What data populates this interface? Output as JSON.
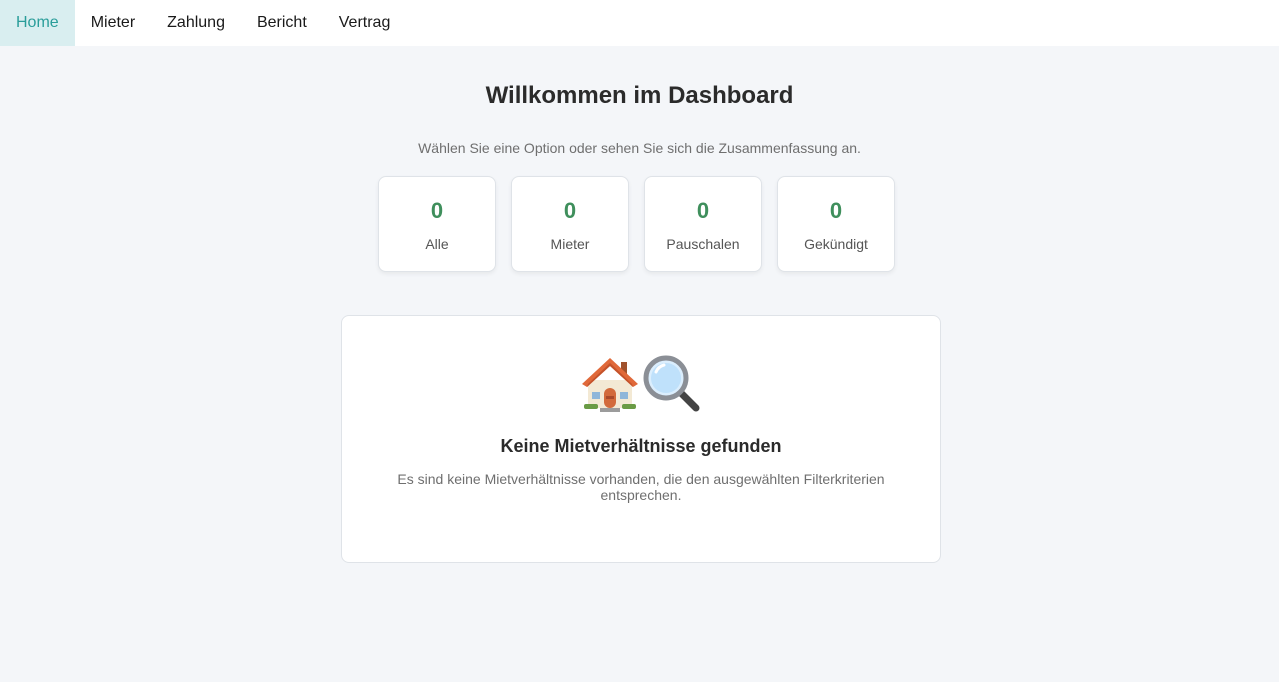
{
  "nav": {
    "items": [
      {
        "label": "Home",
        "active": true
      },
      {
        "label": "Mieter",
        "active": false
      },
      {
        "label": "Zahlung",
        "active": false
      },
      {
        "label": "Bericht",
        "active": false
      },
      {
        "label": "Vertrag",
        "active": false
      }
    ]
  },
  "dashboard": {
    "title": "Willkommen im Dashboard",
    "subtitle": "Wählen Sie eine Option oder sehen Sie sich die Zusammenfassung an.",
    "stats": [
      {
        "value": "0",
        "label": "Alle"
      },
      {
        "value": "0",
        "label": "Mieter"
      },
      {
        "value": "0",
        "label": "Pauschalen"
      },
      {
        "value": "0",
        "label": "Gekündigt"
      }
    ]
  },
  "empty_state": {
    "icons": [
      "house-icon",
      "magnifying-glass-icon"
    ],
    "title": "Keine Mietverhältnisse gefunden",
    "text": "Es sind keine Mietverhältnisse vorhanden, die den ausgewählten Filterkriterien entsprechen."
  },
  "colors": {
    "accent": "#2a9d9a",
    "nav_active_bg": "#d9eef0",
    "stat_value": "#3f8f5c",
    "background": "#f4f6f9"
  }
}
